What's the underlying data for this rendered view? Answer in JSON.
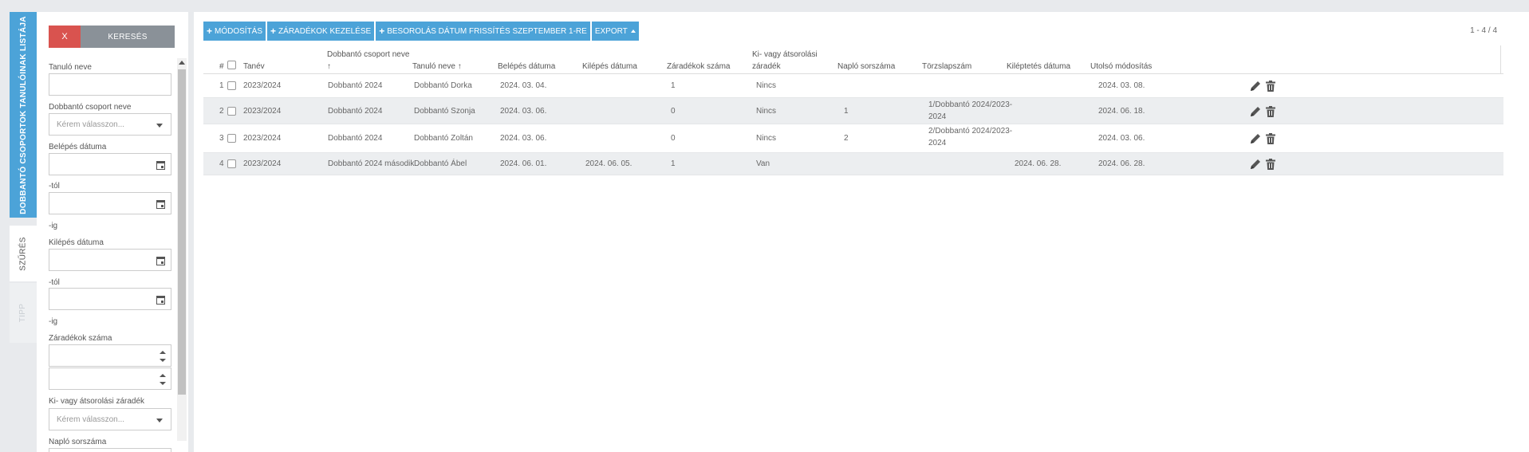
{
  "side_tabs": {
    "list": "DOBBANTÓ CSOPORTOK TANULÓINAK LISTÁJA",
    "filter": "SZŰRÉS",
    "tip": "TIPP"
  },
  "filter": {
    "clear_label": "X",
    "search_label": "KERESÉS",
    "student_name_label": "Tanuló neve",
    "group_name_label": "Dobbantó csoport neve",
    "group_name_placeholder": "Kérem válasszon...",
    "entry_date_label": "Belépés dátuma",
    "from_label": "-tól",
    "to_label": "-ig",
    "exit_date_label": "Kilépés dátuma",
    "exit_from_label": "-tól",
    "exit_to_label": "-ig",
    "clauses_count_label": "Záradékok száma",
    "clause_label": "Ki- vagy átsorolási záradék",
    "clause_placeholder": "Kérem válasszon...",
    "journal_label": "Napló sorszáma"
  },
  "toolbar": {
    "modify": "MÓDOSÍTÁS",
    "clauses": "ZÁRADÉKOK KEZELÉSE",
    "classification": "BESOROLÁS DÁTUM FRISSÍTÉS SZEPTEMBER 1-RE",
    "export": "EXPORT"
  },
  "pager": "1 - 4 / 4",
  "columns": {
    "num": "#",
    "year": "Tanév",
    "group": "Dobbantó csoport neve",
    "student": "Tanuló neve",
    "entry": "Belépés dátuma",
    "exit": "Kilépés dátuma",
    "clauses": "Záradékok száma",
    "clause_type_1": "Ki- vagy átsorolási",
    "clause_type_2": "záradék",
    "journal": "Napló sorszáma",
    "register": "Törzslapszám",
    "release": "Kiléptetés dátuma",
    "modified": "Utolsó módosítás",
    "sort_arrow": "↑"
  },
  "rows": [
    {
      "num": "1",
      "year": "2023/2024",
      "group": "Dobbantó 2024",
      "student": "Dobbantó Dorka",
      "entry": "2024. 03. 04.",
      "exit": "",
      "clauses": "1",
      "clause_type": "Nincs",
      "journal": "",
      "register_1": "",
      "register_2": "",
      "release": "",
      "modified": "2024. 03. 08."
    },
    {
      "num": "2",
      "year": "2023/2024",
      "group": "Dobbantó 2024",
      "student": "Dobbantó Szonja",
      "entry": "2024. 03. 06.",
      "exit": "",
      "clauses": "0",
      "clause_type": "Nincs",
      "journal": "1",
      "register_1": "1/Dobbantó 2024/2023-",
      "register_2": "2024",
      "release": "",
      "modified": "2024. 06. 18."
    },
    {
      "num": "3",
      "year": "2023/2024",
      "group": "Dobbantó 2024",
      "student": "Dobbantó Zoltán",
      "entry": "2024. 03. 06.",
      "exit": "",
      "clauses": "0",
      "clause_type": "Nincs",
      "journal": "2",
      "register_1": "2/Dobbantó 2024/2023-",
      "register_2": "2024",
      "release": "",
      "modified": "2024. 03. 06."
    },
    {
      "num": "4",
      "year": "2023/2024",
      "group": "Dobbantó 2024 második",
      "student": "Dobbantó Ábel",
      "entry": "2024. 06. 01.",
      "exit": "2024. 06. 05.",
      "clauses": "1",
      "clause_type": "Van",
      "journal": "",
      "register_1": "",
      "register_2": "",
      "release": "2024. 06. 28.",
      "modified": "2024. 06. 28."
    }
  ]
}
